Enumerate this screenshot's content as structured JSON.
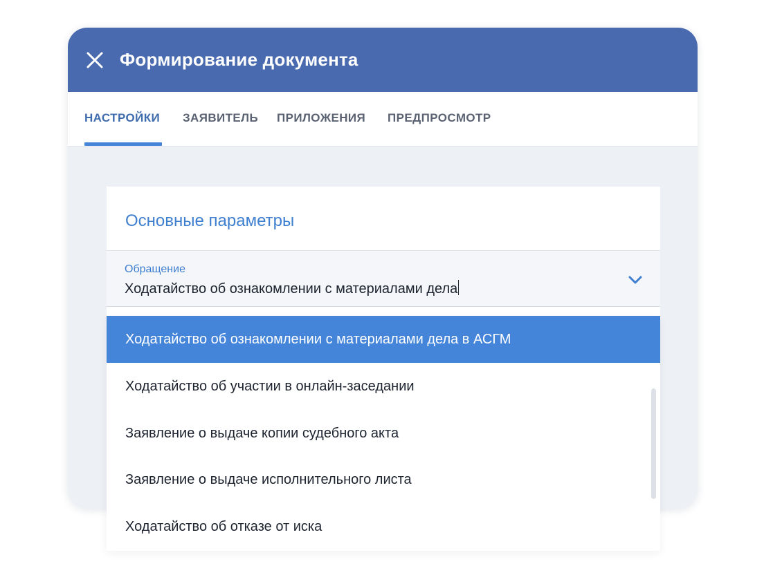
{
  "header": {
    "title": "Формирование документа",
    "close_icon": "close-icon"
  },
  "tabs": [
    {
      "label": "НАСТРОЙКИ",
      "active": true
    },
    {
      "label": "ЗАЯВИТЕЛЬ",
      "active": false
    },
    {
      "label": "ПРИЛОЖЕНИЯ",
      "active": false
    },
    {
      "label": "ПРЕДПРОСМОТР",
      "active": false
    }
  ],
  "section": {
    "title": "Основные параметры"
  },
  "field": {
    "label": "Обращение",
    "value": "Ходатайство об ознакомлении с материалами дела",
    "icon": "chevron-down-icon"
  },
  "dropdown": {
    "options": [
      {
        "label": "Ходатайство об ознакомлении с материалами дела в АСГМ",
        "selected": true
      },
      {
        "label": "Ходатайство об участии в онлайн-заседании",
        "selected": false
      },
      {
        "label": "Заявление о выдаче копии судебного акта",
        "selected": false
      },
      {
        "label": "Заявление о выдаче исполнительного листа",
        "selected": false
      },
      {
        "label": "Ходатайство об отказе от иска",
        "selected": false
      }
    ]
  },
  "colors": {
    "header_bg": "#4a6ab0",
    "accent": "#4485d9",
    "accent_text": "#3f7fd0",
    "tab_active": "#3f6cad",
    "tab_inactive": "#5a6272",
    "panel_bg": "#edf0f4",
    "field_bg": "#f4f6f9",
    "text": "#1d232e"
  }
}
